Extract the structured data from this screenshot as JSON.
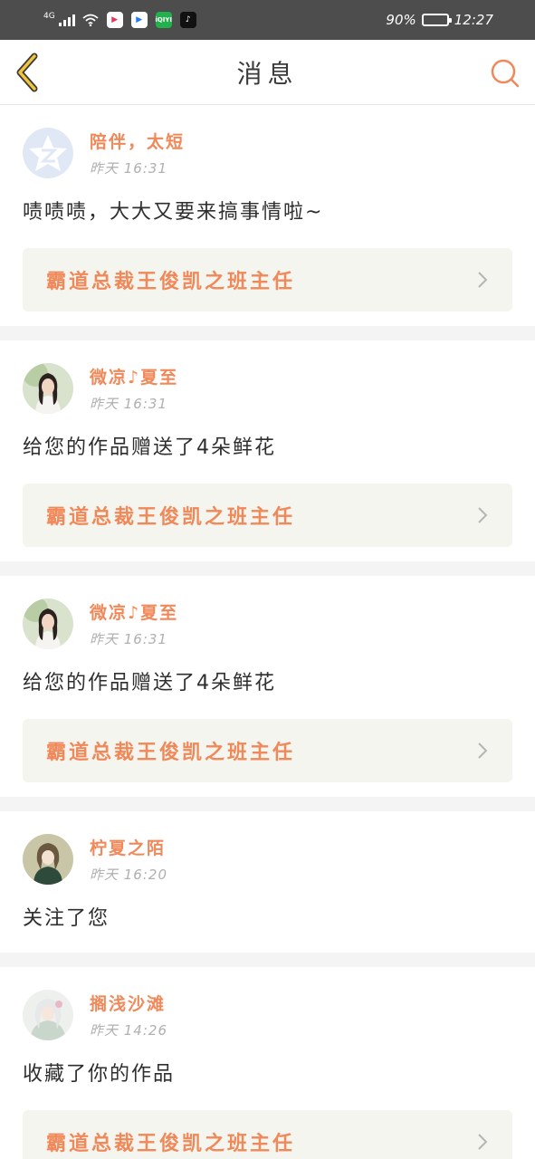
{
  "status_bar": {
    "network": "4G",
    "apps": [
      {
        "icon": "video-app-icon",
        "glyph": "▶"
      },
      {
        "icon": "youku-app-icon",
        "glyph": "▶"
      },
      {
        "icon": "iqiyi-app-icon",
        "glyph": "iQIYI"
      },
      {
        "icon": "tiktok-app-icon",
        "glyph": "♪"
      }
    ],
    "battery": "90%",
    "battery_level": 0.9,
    "time": "12:27"
  },
  "header": {
    "title": "消息",
    "back_icon": "chevron-left-icon",
    "search_icon": "search-icon"
  },
  "colors": {
    "accent": "#f0895a",
    "back_icon": "#f2c43a"
  },
  "messages": [
    {
      "user": "陪伴，太短",
      "avatar": "qzone-default-avatar",
      "time": "昨天 16:31",
      "text": "啧啧啧，大大又要来搞事情啦~",
      "link": "霸道总裁王俊凯之班主任"
    },
    {
      "user": "微凉♪夏至",
      "avatar": "girl-photo-avatar",
      "time": "昨天 16:31",
      "text": "给您的作品赠送了4朵鲜花",
      "link": "霸道总裁王俊凯之班主任"
    },
    {
      "user": "微凉♪夏至",
      "avatar": "girl-photo-avatar",
      "time": "昨天 16:31",
      "text": "给您的作品赠送了4朵鲜花",
      "link": "霸道总裁王俊凯之班主任"
    },
    {
      "user": "柠夏之陌",
      "avatar": "anime-girl-avatar",
      "time": "昨天 16:20",
      "text": "关注了您"
    },
    {
      "user": "搁浅沙滩",
      "avatar": "anime-character-avatar",
      "time": "昨天 14:26",
      "text": "收藏了你的作品",
      "link": "霸道总裁王俊凯之班主任"
    }
  ]
}
